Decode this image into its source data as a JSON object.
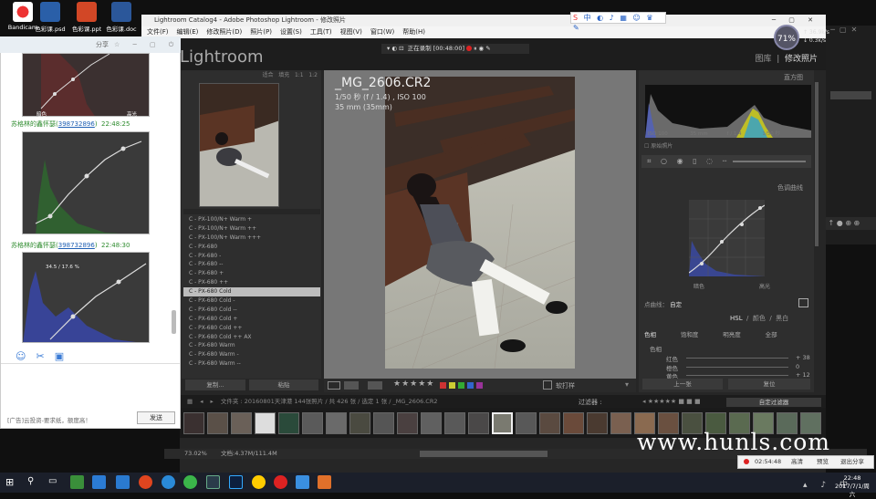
{
  "desktop": {
    "icons": [
      {
        "label": "Bandicam"
      },
      {
        "label": "色彩课.psd"
      },
      {
        "label": "色彩课.ppt"
      },
      {
        "label": "色彩课.doc"
      }
    ]
  },
  "lr": {
    "title": "Lightroom Catalog4 - Adobe Photoshop Lightroom - 修改照片",
    "menu": [
      "文件(F)",
      "编辑(E)",
      "修改照片(D)",
      "照片(P)",
      "设置(S)",
      "工具(T)",
      "视图(V)",
      "窗口(W)",
      "帮助(H)"
    ],
    "logo": "Lightroom",
    "modules": {
      "library": "图库",
      "develop": "修改照片"
    },
    "recorder": "正在录制 [00:48:00]",
    "left": {
      "nav_tabs": [
        "适合",
        "填充",
        "1:1",
        "1:2"
      ],
      "presets": [
        "C - PX-100/N+ Warm +",
        "C - PX-100/N+ Warm ++",
        "C - PX-100/N+ Warm +++",
        "C - PX-680",
        "C - PX-680 -",
        "C - PX-680 --",
        "C - PX-680 +",
        "C - PX-680 ++",
        "C - PX-680 Cold",
        "C - PX-680 Cold -",
        "C - PX-680 Cold --",
        "C - PX-680 Cold +",
        "C - PX-680 Cold ++",
        "C - PX-680 Cold ++ AX",
        "C - PX-680 Warm",
        "C - PX-680 Warm -",
        "C - PX-680 Warm --"
      ],
      "selected_index": 8,
      "btn_copy": "复制...",
      "btn_paste": "粘贴"
    },
    "photo": {
      "filename": "_MG_2606.CR2",
      "exposure": "1/50 秒 (f / 1.4) , ISO 100",
      "lens": "35 mm (35mm)"
    },
    "toolbar": {
      "label": "软打样"
    },
    "right": {
      "histogram_title": "直方图",
      "hist_labels": [
        "ISO 100",
        "35 mm",
        "f / 1.4",
        "1/50 秒"
      ],
      "original": "原始照片",
      "curve_title": "色调曲线",
      "region_dark": "暗色",
      "region_highlight": "高光",
      "channel_label": "点曲线：",
      "channel_value": "自定",
      "hsl_title": "HSL",
      "hsl_tabs": [
        "颜色",
        "黑白"
      ],
      "hsl_sub": [
        "色相",
        "饱和度",
        "明亮度",
        "全部"
      ],
      "hsl_section": "色相",
      "hsl_rows": [
        {
          "name": "红色",
          "value": "+ 38"
        },
        {
          "name": "橙色",
          "value": "0"
        },
        {
          "name": "黄色",
          "value": "+ 12"
        }
      ],
      "btn_prev": "上一张",
      "btn_reset": "复位"
    },
    "filmstrip": {
      "path": "文件夹 : 20160801天津港   144张照片 / 共 426 张 / 选定 1 张 / _MG_2606.CR2",
      "filter_label": "过滤器 :",
      "filter_value": "自定过滤器"
    },
    "status": {
      "zoom": "73.02%",
      "file": "文档:4.37M/111.4M"
    }
  },
  "chat": {
    "header": "分享",
    "messages": [
      {
        "name": "苏格林的鑫怀瑟",
        "qq": "398732896",
        "time": "22:48:25"
      },
      {
        "name": "苏格林的鑫怀瑟",
        "qq": "398732896",
        "time": "22:48:30"
      }
    ],
    "curve_labels": {
      "dark": "暗色",
      "highlight": "高光"
    },
    "img3_label": "34.5 / 17.6 %",
    "ad": "[广告]云投资-要求纸，额度高！",
    "send": "发送"
  },
  "gauge": {
    "value": "71%",
    "up": "↑ 36.9k/s",
    "down": "↓ 0.3k/s"
  },
  "watermark": "www.hunls.com",
  "popup": {
    "time": "02:54:48",
    "a": "高清",
    "b": "预览",
    "c": "退出分享"
  },
  "clock": {
    "time": "22:48",
    "date": "2017/7/1/周六"
  },
  "colors": {
    "lr_bg": "#262626",
    "chat_green": "#2d8b2d",
    "qq_blue": "#1e5fb3"
  }
}
